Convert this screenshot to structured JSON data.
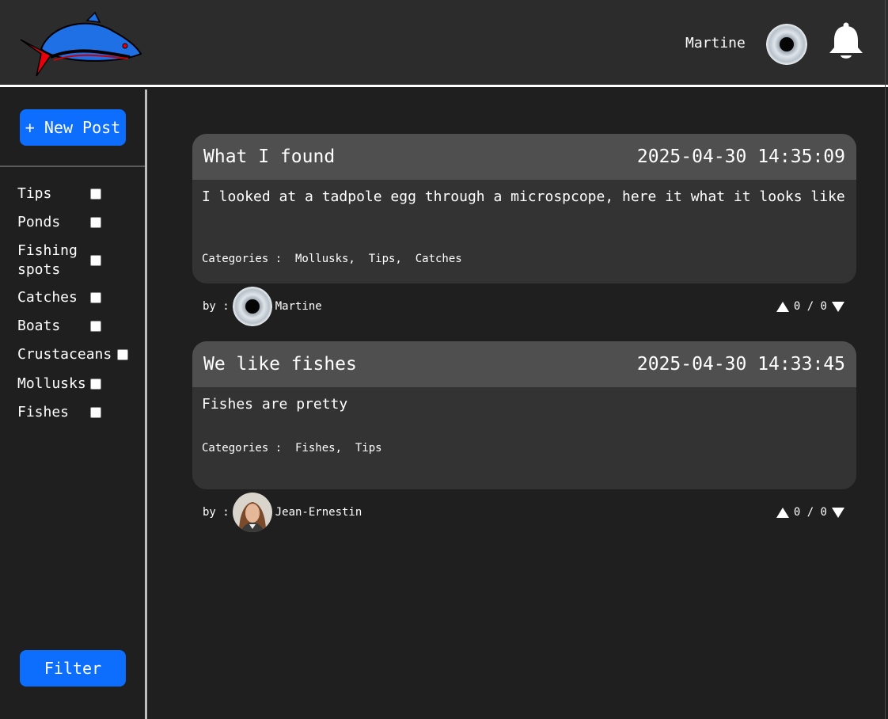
{
  "header": {
    "user_name": "Martine",
    "logo_icon": "fish-logo",
    "bell_icon": "bell-icon"
  },
  "sidebar": {
    "new_post_label": "+ New Post",
    "filter_label": "Filter",
    "categories": [
      {
        "label": "Tips",
        "checked": false
      },
      {
        "label": "Ponds",
        "checked": false
      },
      {
        "label": "Fishing spots",
        "checked": false
      },
      {
        "label": "Catches",
        "checked": false
      },
      {
        "label": "Boats",
        "checked": false
      },
      {
        "label": "Crustaceans",
        "checked": false
      },
      {
        "label": "Mollusks",
        "checked": false
      },
      {
        "label": "Fishes",
        "checked": false
      }
    ]
  },
  "posts": [
    {
      "title": "What I found",
      "date": "2025-04-30 14:35:09",
      "body": "I looked at a tadpole egg through a microspcope, here it what it looks like",
      "categories_text": "Categories :  Mollusks,  Tips,  Catches",
      "by_label": "by :",
      "author": "Martine",
      "votes_text": "0 / 0"
    },
    {
      "title": "We like fishes",
      "date": "2025-04-30 14:33:45",
      "body": "Fishes are pretty",
      "categories_text": "Categories :  Fishes,  Tips",
      "by_label": "by :",
      "author": "Jean-Ernestin",
      "votes_text": "0 / 0"
    }
  ],
  "colors": {
    "background": "#1f1f1f",
    "header": "#2c2c2c",
    "card": "#333333",
    "card_header": "#4f4f4f",
    "accent_blue": "#0d6efd"
  }
}
